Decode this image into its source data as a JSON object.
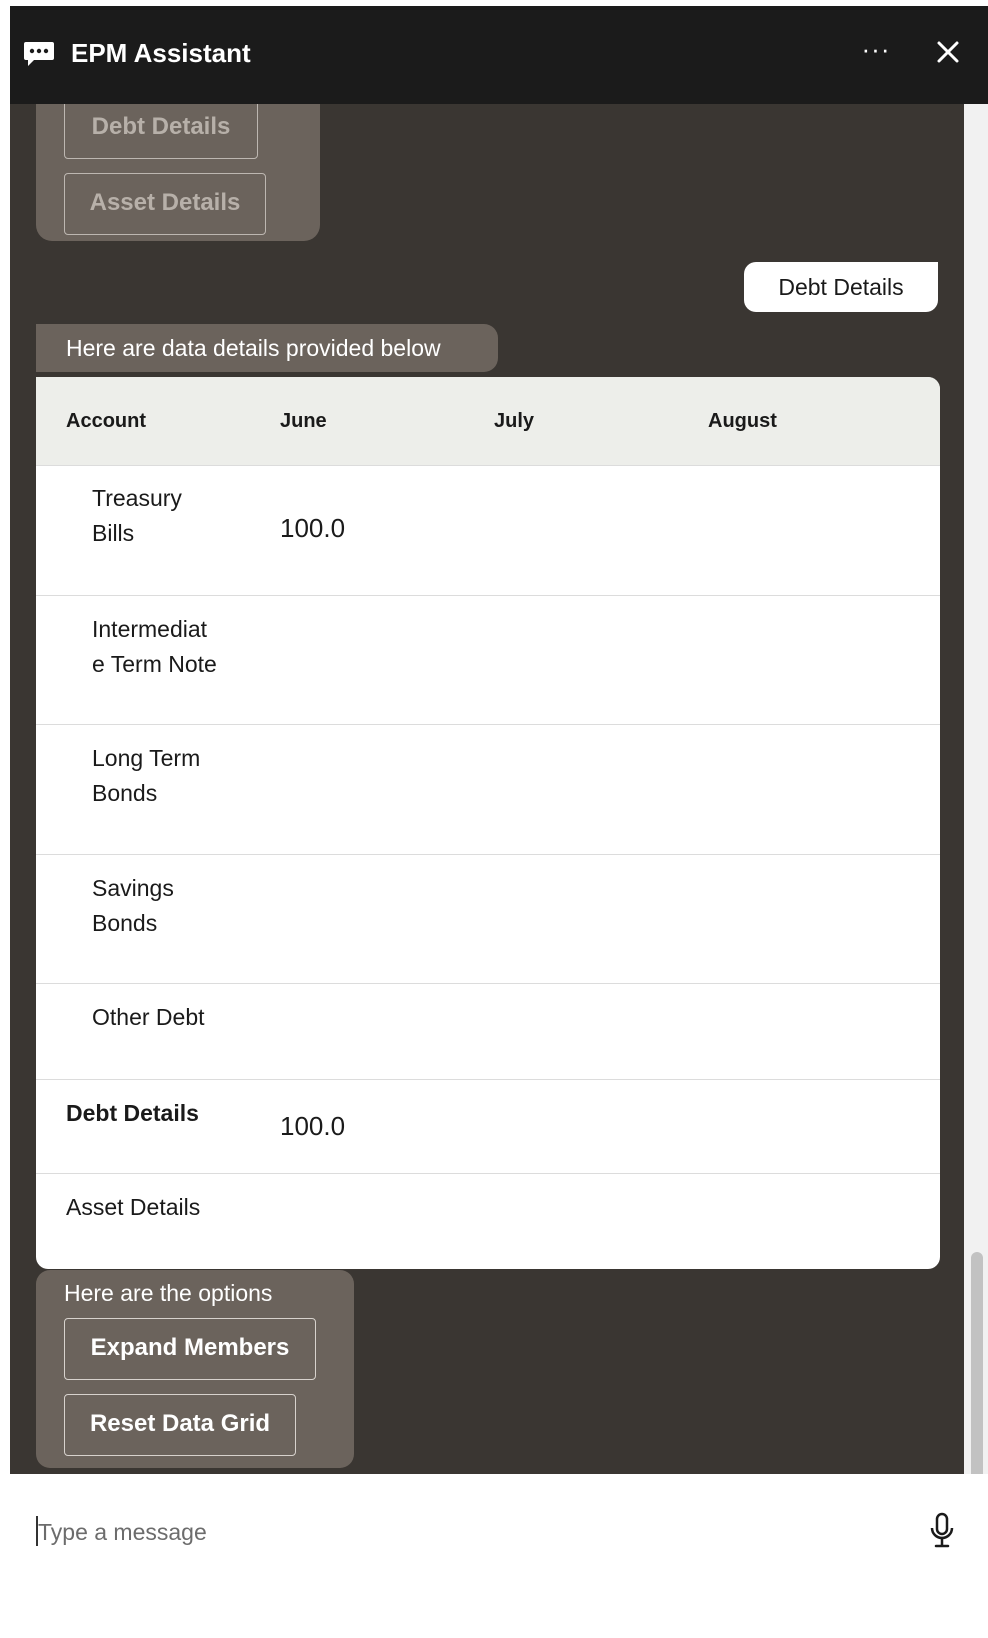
{
  "header": {
    "title": "EPM Assistant",
    "more_label": "···",
    "colors": {
      "background": "#1b1b1b",
      "text": "#ffffff"
    }
  },
  "conversation": {
    "top_options": [
      "Debt Details",
      "Asset Details"
    ],
    "user_message": "Debt Details",
    "bot_message": "Here are data details provided below",
    "table": {
      "columns": [
        "Account",
        "June",
        "July",
        "August"
      ],
      "rows": [
        {
          "account_line1": "Treasury",
          "account_line2": "Bills",
          "june": "100.0"
        },
        {
          "account_line1": "Intermediat",
          "account_line2": "e Term Note",
          "june": ""
        },
        {
          "account_line1": "Long Term",
          "account_line2": "Bonds",
          "june": ""
        },
        {
          "account_line1": "Savings",
          "account_line2": "Bonds",
          "june": ""
        },
        {
          "account_line1": "Other Debt",
          "account_line2": "",
          "june": ""
        },
        {
          "account_line1": "Debt Details",
          "account_line2": "",
          "june": "100.0"
        },
        {
          "account_line1": "Asset Details",
          "account_line2": "",
          "june": ""
        }
      ]
    },
    "options_lead": "Here are the options",
    "options": [
      "Expand Members",
      "Reset Data Grid"
    ],
    "colors": {
      "background": "#3a3632",
      "bubble": "#6b635c"
    }
  },
  "input": {
    "placeholder": "Type a message",
    "mic_icon": "microphone-icon"
  }
}
